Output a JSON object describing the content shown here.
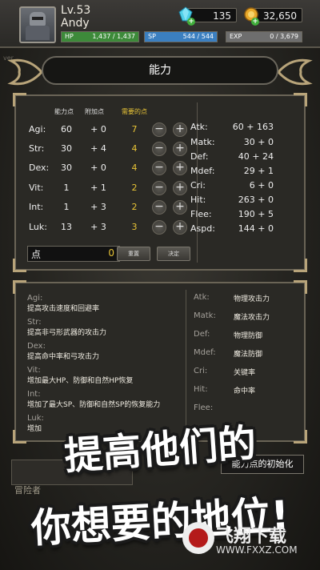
{
  "player": {
    "level": "Lv.53",
    "name": "Andy",
    "gems": "135",
    "gold": "32,650",
    "hp_label": "HP",
    "hp_value": "1,437 / 1,437",
    "hp_fraction": 1.0,
    "sp_label": "SP",
    "sp_value": "544 / 544",
    "sp_fraction": 1.0,
    "exp_label": "EXP",
    "exp_value": "0 / 3,679",
    "exp_fraction": 0.0
  },
  "version_label": "ver",
  "screen": {
    "title": "能力"
  },
  "stats_table": {
    "headers": {
      "points": "能力点",
      "bonus": "附加点",
      "required": "需要的点"
    },
    "rows": [
      {
        "name": "Agi:",
        "points": "60",
        "bonus": "+ 0",
        "required": "7"
      },
      {
        "name": "Str:",
        "points": "30",
        "bonus": "+ 4",
        "required": "4"
      },
      {
        "name": "Dex:",
        "points": "30",
        "bonus": "+ 0",
        "required": "4"
      },
      {
        "name": "Vit:",
        "points": "1",
        "bonus": "+ 1",
        "required": "2"
      },
      {
        "name": "Int:",
        "points": "1",
        "bonus": "+ 3",
        "required": "2"
      },
      {
        "name": "Luk:",
        "points": "13",
        "bonus": "+ 3",
        "required": "3"
      }
    ],
    "points_label": "点",
    "points_value": "0",
    "reset_label": "重置",
    "confirm_label": "决定"
  },
  "derived_stats": [
    {
      "name": "Atk:",
      "value": "60 + 163"
    },
    {
      "name": "Matk:",
      "value": "30 + 0"
    },
    {
      "name": "Def:",
      "value": "40 + 24"
    },
    {
      "name": "Mdef:",
      "value": "29 + 1"
    },
    {
      "name": "Cri:",
      "value": "6 + 0"
    },
    {
      "name": "Hit:",
      "value": "263 + 0"
    },
    {
      "name": "Flee:",
      "value": "190 + 5"
    },
    {
      "name": "Aspd:",
      "value": "144 + 0"
    }
  ],
  "stat_descriptions": [
    {
      "title": "Agi:",
      "text": "提高攻击速度和回避率"
    },
    {
      "title": "Str:",
      "text": "提高非弓形武器的攻击力"
    },
    {
      "title": "Dex:",
      "text": "提高命中率和弓攻击力"
    },
    {
      "title": "Vit:",
      "text": "增加最大HP、防御和自然HP恢复"
    },
    {
      "title": "Int:",
      "text": "增加了最大SP、防御和自然SP的恢复能力"
    },
    {
      "title": "Luk:",
      "text": "增加"
    }
  ],
  "keyword_descriptions": [
    {
      "title": "Atk:",
      "text": "物理攻击力"
    },
    {
      "title": "Matk:",
      "text": "魔法攻击力"
    },
    {
      "title": "Def:",
      "text": "物理防御"
    },
    {
      "title": "Mdef:",
      "text": "魔法防御"
    },
    {
      "title": "Cri:",
      "text": "关键率"
    },
    {
      "title": "Hit:",
      "text": "命中率"
    },
    {
      "title": "Flee:",
      "text": ""
    }
  ],
  "reset_all_label": "能力点的初始化",
  "bottom_left_label": "冒险者",
  "promo": {
    "line1": "提高他们的",
    "line2": "你想要的地位!"
  },
  "watermark": {
    "text": "飞翔下载",
    "url": "WWW.FXXZ.COM"
  },
  "colors": {
    "hp": "#3d8a3a",
    "sp": "#3b7fc0",
    "exp": "#999999",
    "required": "#e8c436"
  }
}
